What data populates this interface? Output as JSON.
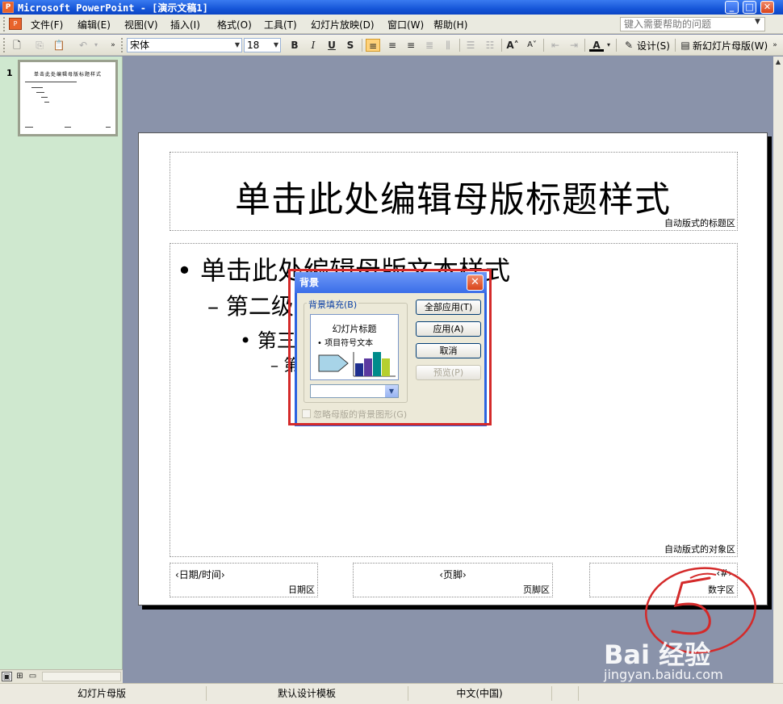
{
  "window": {
    "title": "Microsoft PowerPoint - [演示文稿1]",
    "app_icon": "powerpoint-icon",
    "buttons": [
      "minimize",
      "maximize",
      "close"
    ]
  },
  "menubar": {
    "items": [
      "文件(F)",
      "编辑(E)",
      "视图(V)",
      "插入(I)",
      "格式(O)",
      "工具(T)",
      "幻灯片放映(D)",
      "窗口(W)",
      "帮助(H)"
    ],
    "help_placeholder": "键入需要帮助的问题"
  },
  "toolbar": {
    "font_name": "宋体",
    "font_size": "18",
    "bold": "B",
    "italic": "I",
    "underline": "U",
    "shadow": "S",
    "design_label": "设计(S)",
    "new_master_label": "新幻灯片母版(W)"
  },
  "thumbnail_pane": {
    "slide_number": "1",
    "thumb_title": "单击此处编辑母版标题样式"
  },
  "slide": {
    "title": "单击此处编辑母版标题样式",
    "title_area_label": "自动版式的标题区",
    "level1": "单击此处编辑母版文本样式",
    "level2": "第二级",
    "level3": "第三",
    "level4": "第",
    "object_area_label": "自动版式的对象区",
    "date_text": "‹日期/时间›",
    "date_area_label": "日期区",
    "footer_text": "‹页脚›",
    "footer_area_label": "页脚区",
    "number_text": "‹#›",
    "number_area_label": "数字区"
  },
  "dialog": {
    "title": "背景",
    "group_label": "背景填充(B)",
    "preview_title": "幻灯片标题",
    "preview_bullet": "• 项目符号文本",
    "apply_all": "全部应用(T)",
    "apply": "应用(A)",
    "cancel": "取消",
    "preview": "预览(P)",
    "omit_checkbox": "忽略母版的背景图形(G)",
    "chart_colors": [
      "#1f2f8f",
      "#5c3aa0",
      "#008b8b",
      "#b5cf2f"
    ]
  },
  "annotation": {
    "color": "#d42a2a",
    "number": "5"
  },
  "statusbar": {
    "view": "幻灯片母版",
    "template": "默认设计模板",
    "language": "中文(中国)"
  },
  "watermark": {
    "main": "Bai  经验",
    "url": "jingyan.baidu.com"
  }
}
